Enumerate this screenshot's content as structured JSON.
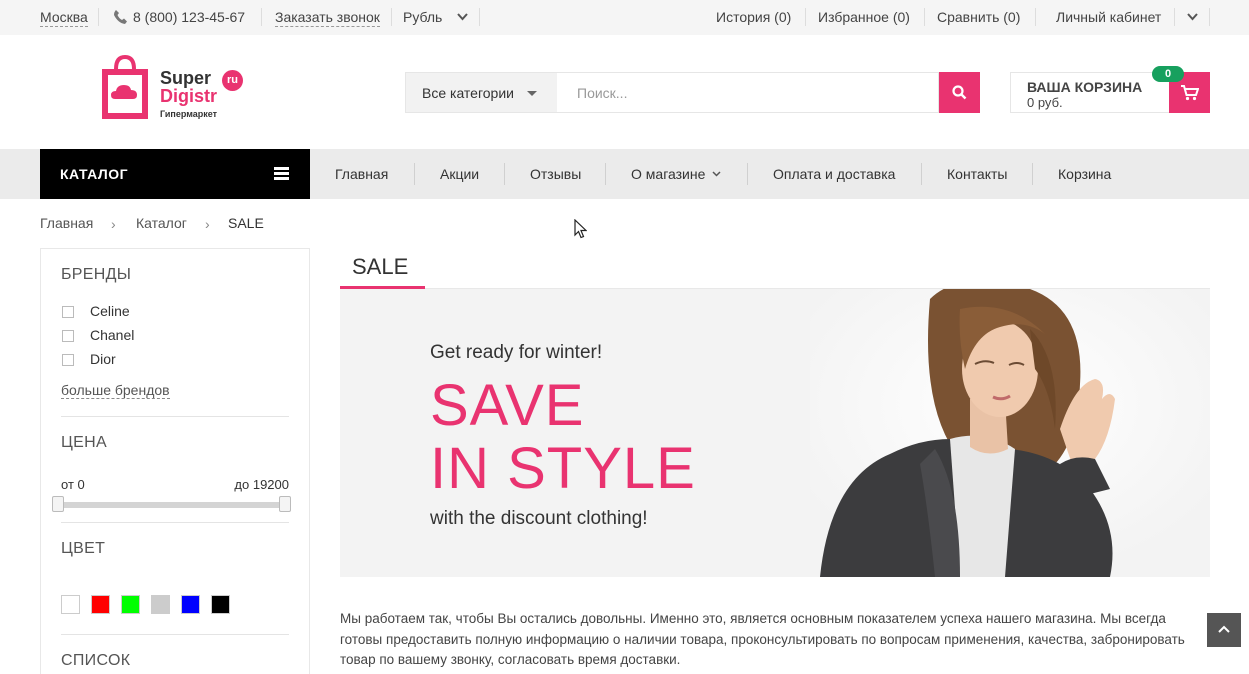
{
  "topbar": {
    "city": "Москва",
    "phone": "8 (800) 123-45-67",
    "callback": "Заказать звонок",
    "currency": "Рубль",
    "history": "История (0)",
    "favorites": "Избранное (0)",
    "compare": "Сравнить (0)",
    "account": "Личный кабинет"
  },
  "logo": {
    "line1": "Super",
    "line2": "Digistr",
    "tagline": "Гипермаркет",
    "badge": "ru"
  },
  "search": {
    "category": "Все категории",
    "placeholder": "Поиск..."
  },
  "cart": {
    "title": "ВАША КОРЗИНА",
    "sum": "0 руб.",
    "count": "0"
  },
  "nav": {
    "catalog": "КАТАЛОГ",
    "items": [
      "Главная",
      "Акции",
      "Отзывы",
      "О магазине",
      "Оплата и доставка",
      "Контакты",
      "Корзина"
    ]
  },
  "breadcrumb": [
    "Главная",
    "Каталог",
    "SALE"
  ],
  "filters": {
    "brands_title": "БРЕНДЫ",
    "brands": [
      "Celine",
      "Chanel",
      "Dior"
    ],
    "more_brands": "больше брендов",
    "price_title": "ЦЕНА",
    "price_from": "от 0",
    "price_to": "до 19200",
    "color_title": "ЦВЕТ",
    "colors": [
      "#ffffff",
      "#ff0000",
      "#00ff00",
      "#cccccc",
      "#0000ff",
      "#000000"
    ],
    "list_title": "СПИСОК"
  },
  "content": {
    "tab": "SALE",
    "banner": {
      "line1": "Get ready for winter!",
      "line2": "SAVE",
      "line3": "IN STYLE",
      "line4": "with the discount clothing!"
    },
    "about": "Мы работаем так, чтобы Вы остались довольны. Именно это, является основным показателем успеха нашего магазина. Мы всегда готовы предоставить полную информацию о наличии товара, проконсультировать по вопросам применения, качества, забронировать товар по вашему звонку, согласовать время доставки."
  },
  "colors": {
    "accent": "#e93370",
    "badge_green": "#17a05e"
  }
}
